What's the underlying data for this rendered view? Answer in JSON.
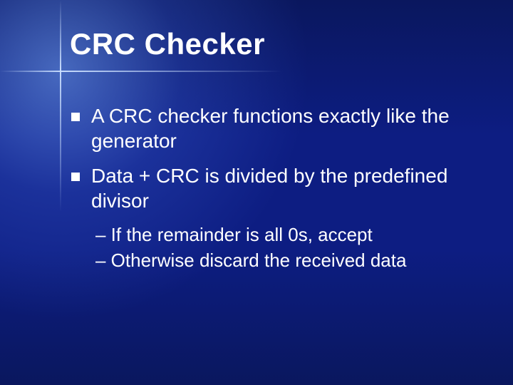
{
  "title": "CRC Checker",
  "bullets": [
    {
      "text": "A CRC checker functions exactly like the generator"
    },
    {
      "text": "Data + CRC is divided by the predefined divisor"
    }
  ],
  "sub_bullets": [
    {
      "text": "– If the remainder is all 0s, accept"
    },
    {
      "text": "– Otherwise discard the received data"
    }
  ]
}
